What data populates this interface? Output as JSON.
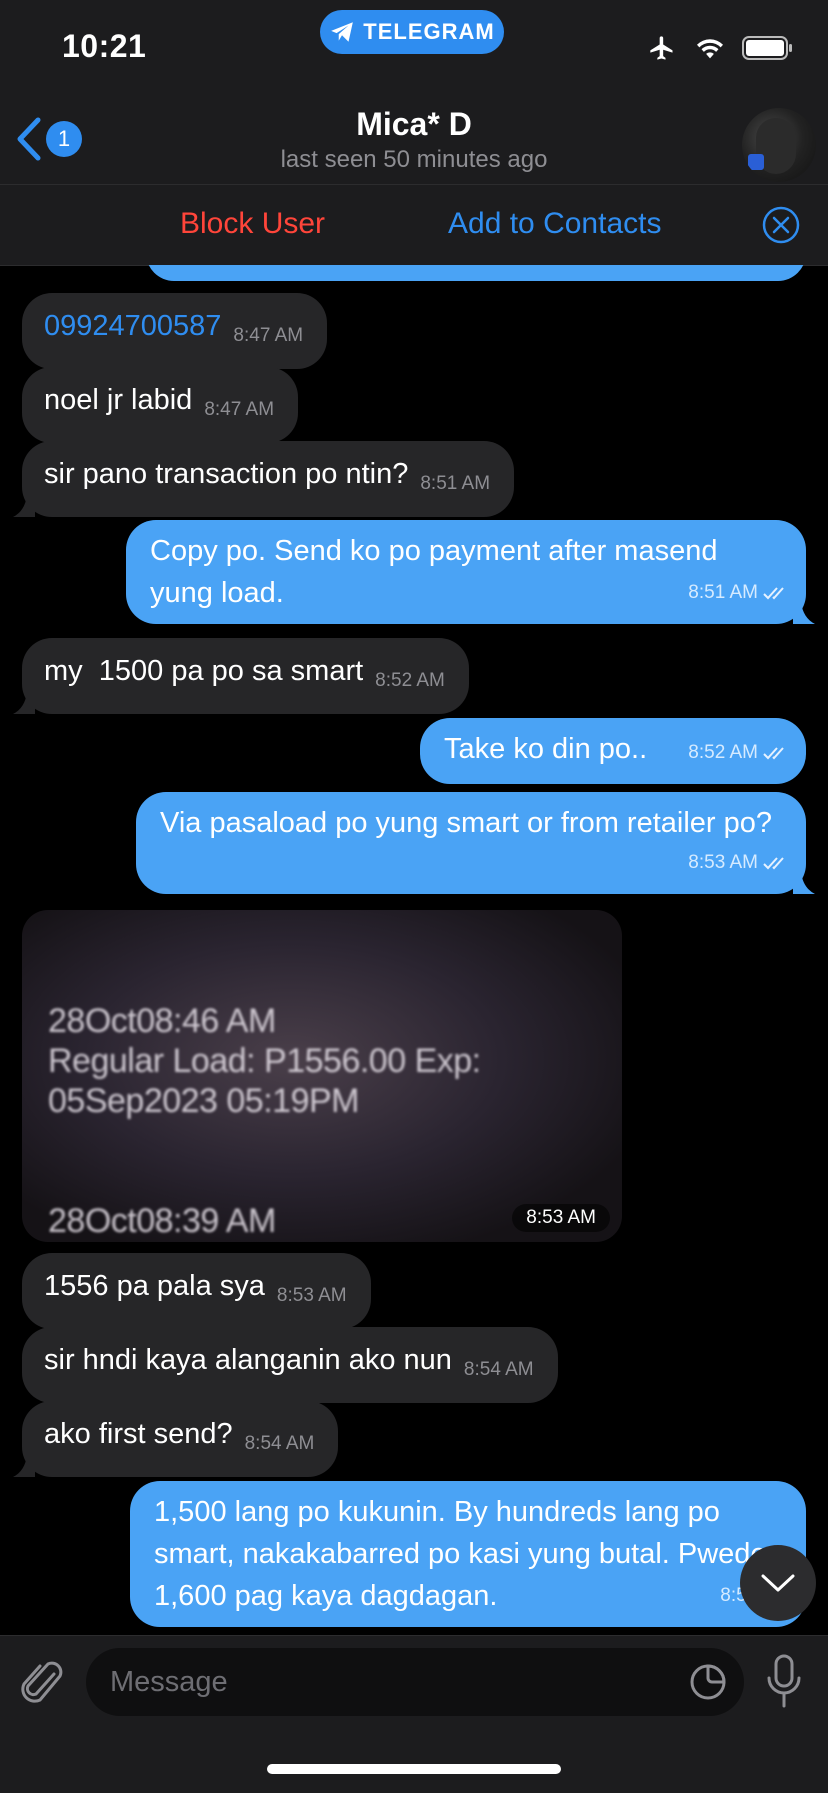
{
  "status_bar": {
    "time": "10:21",
    "app_pill": "TELEGRAM"
  },
  "header": {
    "back_badge": "1",
    "contact_name": "Mica* D",
    "last_seen": "last seen 50 minutes ago"
  },
  "action_bar": {
    "block_label": "Block User",
    "add_label": "Add to Contacts"
  },
  "messages": [
    {
      "dir": "in",
      "text": "09924700587",
      "time": "8:47 AM",
      "is_link": true
    },
    {
      "dir": "in",
      "text": "noel jr labid",
      "time": "8:47 AM"
    },
    {
      "dir": "in",
      "text": "sir pano transaction po ntin?",
      "time": "8:51 AM"
    },
    {
      "dir": "out",
      "text": "Copy po. Send ko po payment after masend yung load.",
      "time": "8:51 AM",
      "read": true
    },
    {
      "dir": "in",
      "text": "my  1500 pa po sa smart",
      "time": "8:52 AM"
    },
    {
      "dir": "out",
      "text": "Take ko din po..",
      "time": "8:52 AM",
      "read": true
    },
    {
      "dir": "out",
      "text": "Via pasaload po yung smart or from retailer po?",
      "time": "8:53 AM",
      "read": true
    },
    {
      "dir": "in",
      "type": "photo",
      "time": "8:53 AM",
      "photo_lines": [
        "28Oct08:46 AM",
        "Regular Load: P1556.00 Exp:",
        "05Sep2023 05:19PM",
        "28Oct08:39 AM"
      ]
    },
    {
      "dir": "in",
      "text": "1556 pa pala sya",
      "time": "8:53 AM"
    },
    {
      "dir": "in",
      "text": "sir hndi kaya alanganin ako nun",
      "time": "8:54 AM"
    },
    {
      "dir": "in",
      "text": "ako first send?",
      "time": "8:54 AM"
    },
    {
      "dir": "out",
      "text": "1,500 lang po kukunin. By hundreds lang po smart, nakakabarred po kasi yung butal. Pwede 1,600 pag kaya dagdagan.",
      "time": "8:55 AM"
    }
  ],
  "composer": {
    "placeholder": "Message"
  },
  "colors": {
    "accent": "#2f8df0",
    "outgoing_bubble": "#4aa3f5",
    "incoming_bubble": "#262628",
    "danger": "#ff453a"
  },
  "icons": [
    "paperplane-icon",
    "airplane-icon",
    "wifi-icon",
    "battery-icon",
    "back-chevron-icon",
    "close-circle-icon",
    "double-check-icon",
    "chevron-down-icon",
    "paperclip-icon",
    "sticker-icon",
    "microphone-icon"
  ]
}
